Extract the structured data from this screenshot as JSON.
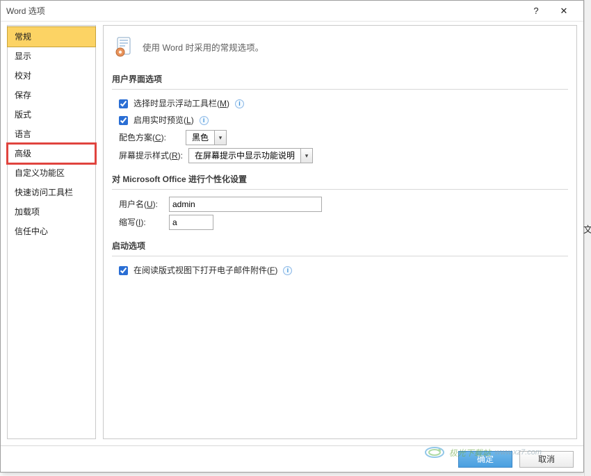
{
  "title": "Word 选项",
  "titlebar": {
    "help": "?",
    "close": "✕"
  },
  "sidebar": {
    "items": [
      {
        "label": "常规",
        "selected": true
      },
      {
        "label": "显示"
      },
      {
        "label": "校对"
      },
      {
        "label": "保存"
      },
      {
        "label": "版式"
      },
      {
        "label": "语言"
      },
      {
        "label": "高级",
        "highlight": true
      },
      {
        "label": "自定义功能区"
      },
      {
        "label": "快速访问工具栏"
      },
      {
        "label": "加载项"
      },
      {
        "label": "信任中心"
      }
    ]
  },
  "banner": {
    "text": "使用 Word 时采用的常规选项。"
  },
  "section_ui": {
    "heading": "用户界面选项",
    "opt_mini_toolbar": "选择时显示浮动工具栏(",
    "opt_mini_toolbar_k": "M",
    "opt_mini_toolbar_end": ")",
    "opt_live_preview": "启用实时预览(",
    "opt_live_preview_k": "L",
    "opt_live_preview_end": ")",
    "color_label": "配色方案(",
    "color_k": "C",
    "color_end": "):",
    "color_value": "黑色",
    "tooltip_label": "屏幕提示样式(",
    "tooltip_k": "R",
    "tooltip_end": "):",
    "tooltip_value": "在屏幕提示中显示功能说明"
  },
  "section_personal": {
    "heading": "对 Microsoft Office 进行个性化设置",
    "username_label": "用户名(",
    "username_k": "U",
    "username_end": "):",
    "username_value": "admin",
    "initials_label": "缩写(",
    "initials_k": "I",
    "initials_end": "):",
    "initials_value": "a"
  },
  "section_startup": {
    "heading": "启动选项",
    "opt_open_attachments": "在阅读版式视图下打开电子邮件附件(",
    "opt_open_attachments_k": "F",
    "opt_open_attachments_end": ")"
  },
  "footer": {
    "ok": "确定",
    "cancel": "取消"
  },
  "watermark": {
    "brand": "极光下载站",
    "url": "www.xz7.com"
  },
  "edge_char": "文"
}
